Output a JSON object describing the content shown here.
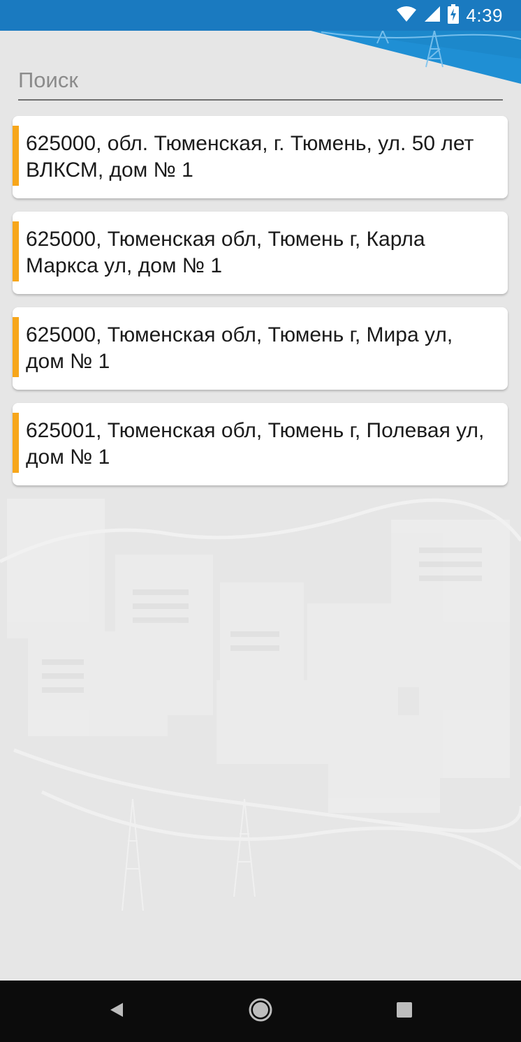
{
  "status_bar": {
    "time": "4:39",
    "icons": [
      "wifi-icon",
      "cellular-signal-icon",
      "battery-charging-icon"
    ]
  },
  "search": {
    "placeholder": "Поиск",
    "value": ""
  },
  "addresses": [
    {
      "text": "625000, обл. Тюменская, г. Тюмень, ул. 50 лет ВЛКСМ, дом № 1"
    },
    {
      "text": "625000, Тюменская обл, Тюмень г, Карла Маркса ул, дом № 1"
    },
    {
      "text": "625000, Тюменская обл, Тюмень г, Мира ул, дом № 1"
    },
    {
      "text": "625001, Тюменская обл, Тюмень г, Полевая ул, дом № 1"
    }
  ],
  "nav_bar": {
    "icons": [
      "back-icon",
      "home-icon",
      "recents-icon"
    ]
  },
  "colors": {
    "status_bar": "#1a7ac0",
    "accent": "#f7a61a",
    "background": "#e6e6e6",
    "card": "#ffffff"
  }
}
